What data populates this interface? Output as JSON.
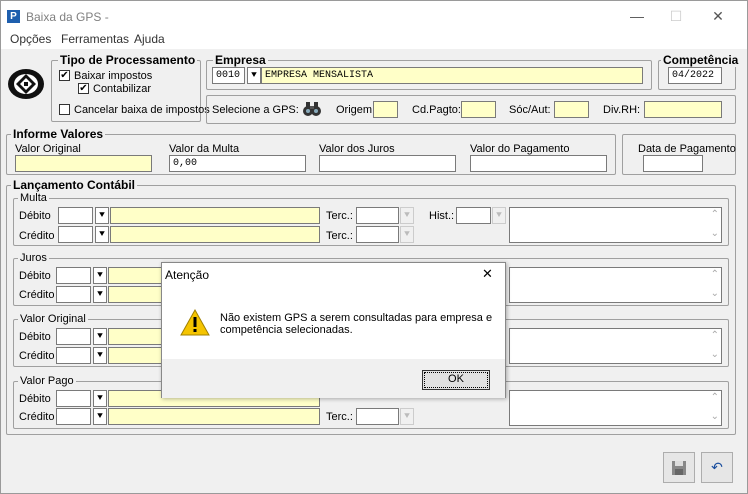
{
  "window": {
    "title": "Baixa da GPS -",
    "min": "—",
    "max": "☐",
    "close": "✕"
  },
  "menu": [
    "Opções",
    "Ferramentas",
    "Ajuda"
  ],
  "tipo": {
    "title": "Tipo de Processamento",
    "baixar": "Baixar impostos",
    "contabilizar": "Contabilizar",
    "cancelar": "Cancelar baixa de impostos",
    "check_mark": "✔"
  },
  "empresa": {
    "title": "Empresa",
    "code": "0010",
    "name": "EMPRESA MENSALISTA"
  },
  "competencia": {
    "title": "Competência",
    "value": "04/2022"
  },
  "gps": {
    "selecione": "Selecione a GPS:",
    "origem": "Origem:",
    "cdpagto": "Cd.Pagto:",
    "socaut": "Sóc/Aut:",
    "divrh": "Div.RH:"
  },
  "informe": {
    "title": "Informe Valores",
    "original": "Valor Original",
    "multa": "Valor da Multa",
    "multa_value": "0,00",
    "juros": "Valor dos Juros",
    "pagamento": "Valor do Pagamento",
    "data_pagamento": "Data de Pagamento"
  },
  "lancamento": {
    "title": "Lançamento Contábil",
    "debito": "Débito",
    "credito": "Crédito",
    "terc": "Terc.:",
    "hist": "Hist.:",
    "sections": [
      "Multa",
      "Juros",
      "Valor Original",
      "Valor Pago"
    ]
  },
  "dialog": {
    "title": "Atenção",
    "close": "✕",
    "message_line1": "Não existem GPS a serem consultadas para empresa e",
    "message_line2": "competência selecionadas.",
    "ok": "OK"
  },
  "icons": {
    "drop": "⯆",
    "up": "⌃",
    "down": "⌄",
    "undo": "↶"
  }
}
